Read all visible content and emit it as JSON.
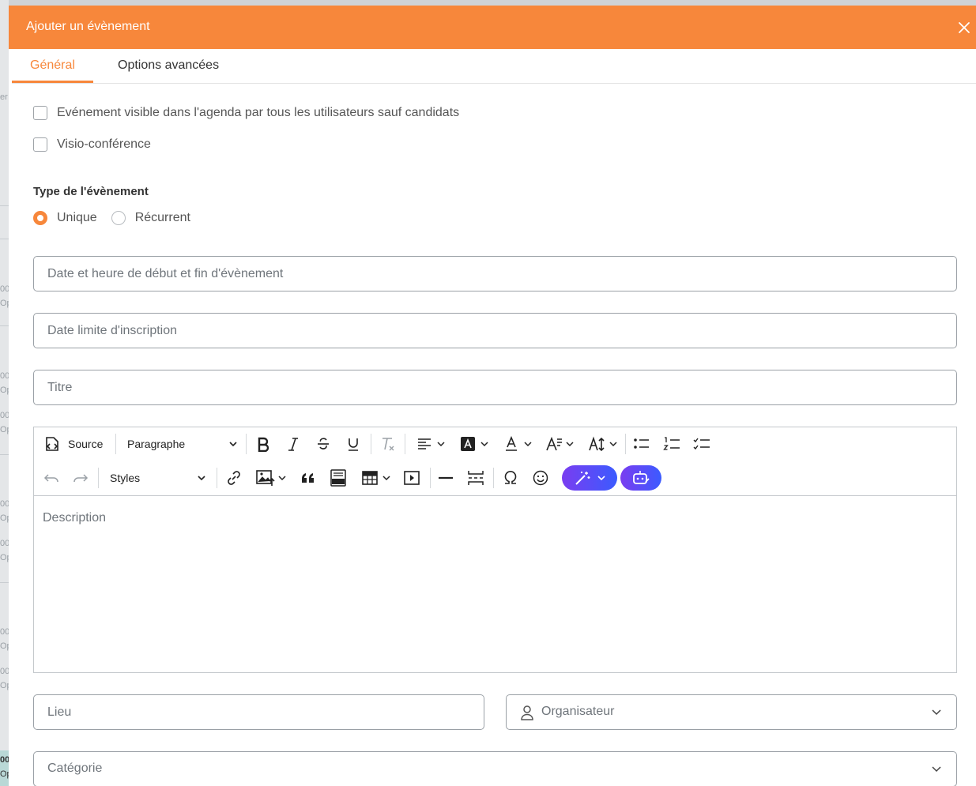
{
  "background": {
    "fragments": [
      "er",
      "00",
      "Op",
      "00",
      "Op",
      "00",
      "Op",
      "00",
      "Op",
      "00",
      "Op",
      "00",
      "Op",
      "00",
      "Op",
      "00",
      "Op"
    ]
  },
  "modal": {
    "title": "Ajouter un évènement",
    "accent_color": "#f7873b",
    "tabs": [
      {
        "label": "Général",
        "active": true
      },
      {
        "label": "Options avancées",
        "active": false
      }
    ],
    "checkboxes": [
      {
        "label": "Evénement visible dans l'agenda par tous les utilisateurs sauf candidats",
        "checked": false
      },
      {
        "label": "Visio-conférence",
        "checked": false
      }
    ],
    "event_type": {
      "label": "Type de l'évènement",
      "options": [
        {
          "label": "Unique",
          "selected": true
        },
        {
          "label": "Récurrent",
          "selected": false
        }
      ]
    },
    "fields": {
      "date_range": {
        "placeholder": "Date et heure de début et fin d'évènement",
        "value": ""
      },
      "deadline": {
        "placeholder": "Date limite d'inscription",
        "value": ""
      },
      "title": {
        "placeholder": "Titre",
        "value": ""
      },
      "location": {
        "placeholder": "Lieu",
        "value": ""
      },
      "organizer": {
        "placeholder": "Organisateur",
        "value": ""
      },
      "category": {
        "placeholder": "Catégorie",
        "value": ""
      }
    },
    "editor": {
      "source_label": "Source",
      "paragraph_label": "Paragraphe",
      "styles_label": "Styles",
      "placeholder": "Description"
    }
  }
}
